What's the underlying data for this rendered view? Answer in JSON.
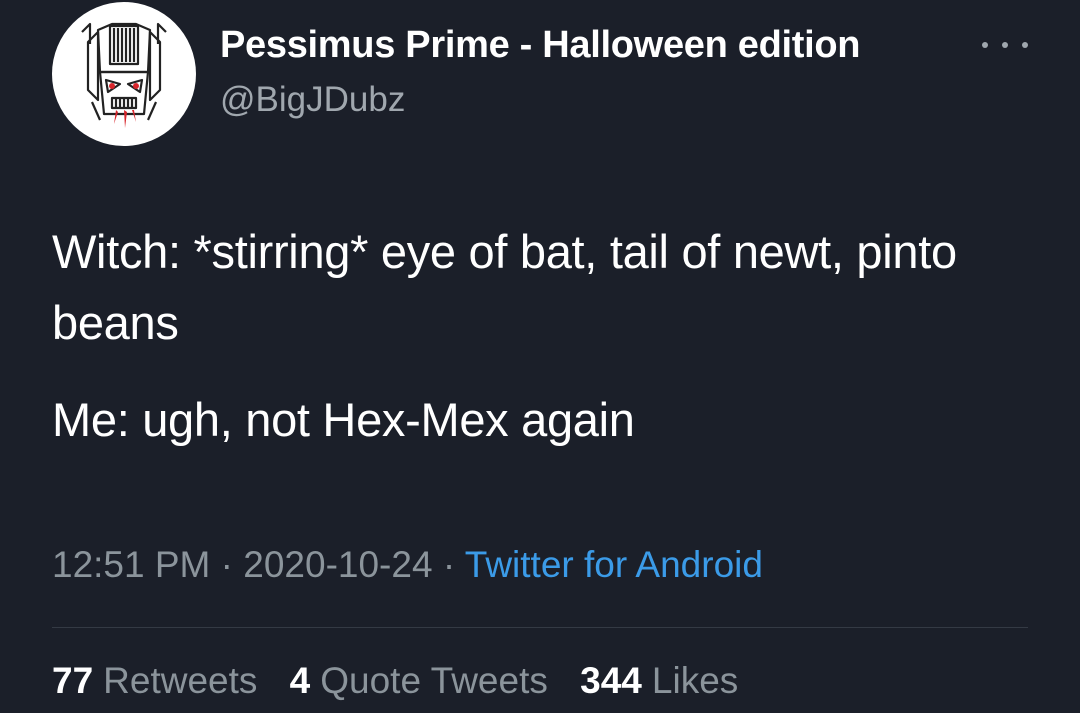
{
  "tweet": {
    "display_name": "Pessimus Prime - Halloween edition",
    "handle": "@BigJDubz",
    "avatar_icon": "robot-head-icon",
    "more_icon": "more-options-icon",
    "lines": [
      "Witch: *stirring* eye of bat, tail of newt, pinto beans",
      "Me: ugh, not Hex-Mex again"
    ],
    "time": "12:51 PM",
    "separator": "·",
    "date": "2020-10-24",
    "source": "Twitter for Android"
  },
  "stats": {
    "retweets_count": "77",
    "retweets_label": "Retweets",
    "quotes_count": "4",
    "quotes_label": "Quote Tweets",
    "likes_count": "344",
    "likes_label": "Likes"
  },
  "colors": {
    "background": "#1b1f29",
    "text": "#ffffff",
    "muted": "#8b949b",
    "link": "#3b9be8"
  }
}
